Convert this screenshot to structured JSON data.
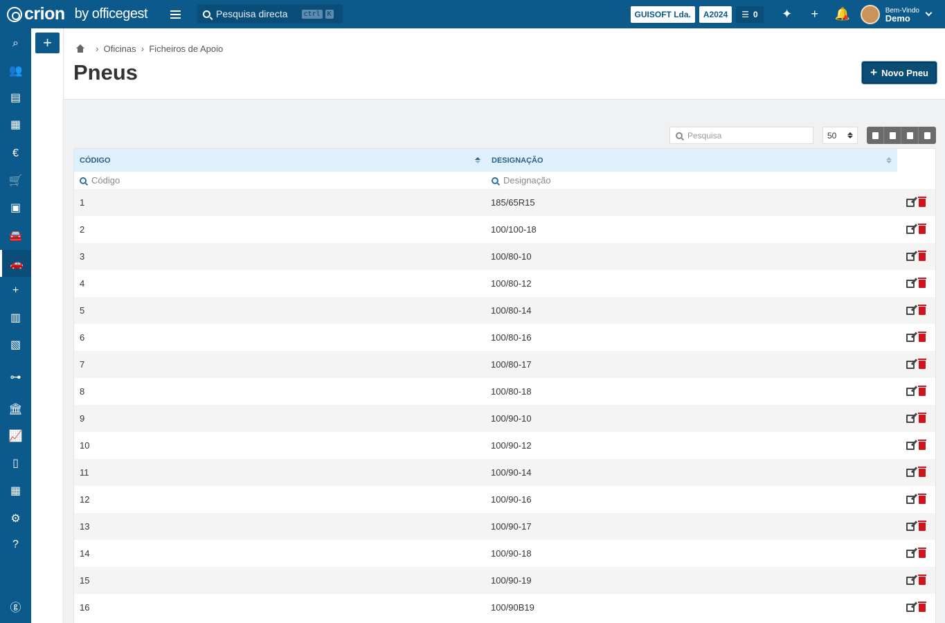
{
  "topbar": {
    "brand": "crion",
    "brand_by": "by officegest",
    "search_placeholder": "Pesquisa directa",
    "kbd_ctrl": "ctrl",
    "kbd_k": "K",
    "company": "GUISOFT Lda.",
    "year": "A2024",
    "tasks_count": "0",
    "user_greeting": "Bem-Vindo",
    "user_name": "Demo",
    "icons": [
      "magic-icon",
      "plus-icon",
      "bell-icon"
    ]
  },
  "sidebar": {
    "items": [
      {
        "name": "search",
        "icon": "search-icon",
        "glyph": "⌕"
      },
      {
        "name": "users",
        "icon": "users-icon",
        "glyph": "👥"
      },
      {
        "name": "book",
        "icon": "book-icon",
        "glyph": "▤"
      },
      {
        "name": "warehouse",
        "icon": "warehouse-icon",
        "glyph": "▦"
      },
      {
        "name": "euro",
        "icon": "euro-icon",
        "glyph": "€"
      },
      {
        "name": "cart",
        "icon": "cart-icon",
        "glyph": "🛒"
      },
      {
        "name": "money",
        "icon": "money-icon",
        "glyph": "▣"
      },
      {
        "name": "car-wash",
        "icon": "car-side-icon",
        "glyph": "🚘"
      },
      {
        "name": "car",
        "icon": "car-icon",
        "glyph": "🚗",
        "active": true
      },
      {
        "name": "add",
        "icon": "plus-icon",
        "glyph": "+"
      },
      {
        "name": "calculator",
        "icon": "calculator-icon",
        "glyph": "▥"
      },
      {
        "name": "boxes",
        "icon": "boxes-icon",
        "glyph": "▧"
      },
      {
        "name": "sitemap",
        "icon": "sitemap-icon",
        "glyph": "⊶"
      },
      {
        "name": "bank",
        "icon": "bank-icon",
        "glyph": "🏛"
      },
      {
        "name": "chart",
        "icon": "chart-icon",
        "glyph": "📈"
      },
      {
        "name": "file",
        "icon": "file-icon",
        "glyph": "▯"
      },
      {
        "name": "table",
        "icon": "table-icon",
        "glyph": "▦"
      },
      {
        "name": "settings",
        "icon": "gears-icon",
        "glyph": "⚙"
      },
      {
        "name": "help",
        "icon": "help-icon",
        "glyph": "?"
      }
    ],
    "bottom_icon": "officegest-logo-icon"
  },
  "header": {
    "breadcrumb": [
      "Oficinas",
      "Ficheiros de Apoio"
    ],
    "title": "Pneus",
    "new_button": "Novo Pneu"
  },
  "tools": {
    "search_placeholder": "Pesquisa",
    "per_page": "50",
    "buttons": [
      "copy-icon",
      "excel-icon",
      "csv-icon",
      "print-icon"
    ]
  },
  "table": {
    "columns": [
      "CÓDIGO",
      "DESIGNAÇÃO"
    ],
    "filters": [
      "Código",
      "Designação"
    ],
    "rows": [
      {
        "code": "1",
        "designation": "185/65R15"
      },
      {
        "code": "2",
        "designation": "100/100-18"
      },
      {
        "code": "3",
        "designation": "100/80-10"
      },
      {
        "code": "4",
        "designation": "100/80-12"
      },
      {
        "code": "5",
        "designation": "100/80-14"
      },
      {
        "code": "6",
        "designation": "100/80-16"
      },
      {
        "code": "7",
        "designation": "100/80-17"
      },
      {
        "code": "8",
        "designation": "100/80-18"
      },
      {
        "code": "9",
        "designation": "100/90-10"
      },
      {
        "code": "10",
        "designation": "100/90-12"
      },
      {
        "code": "11",
        "designation": "100/90-14"
      },
      {
        "code": "12",
        "designation": "100/90-16"
      },
      {
        "code": "13",
        "designation": "100/90-17"
      },
      {
        "code": "14",
        "designation": "100/90-18"
      },
      {
        "code": "15",
        "designation": "100/90-19"
      },
      {
        "code": "16",
        "designation": "100/90B19"
      }
    ]
  },
  "colors": {
    "primary": "#0c5a8c",
    "header_bg": "#ddf0fb",
    "danger": "#d0141b"
  }
}
